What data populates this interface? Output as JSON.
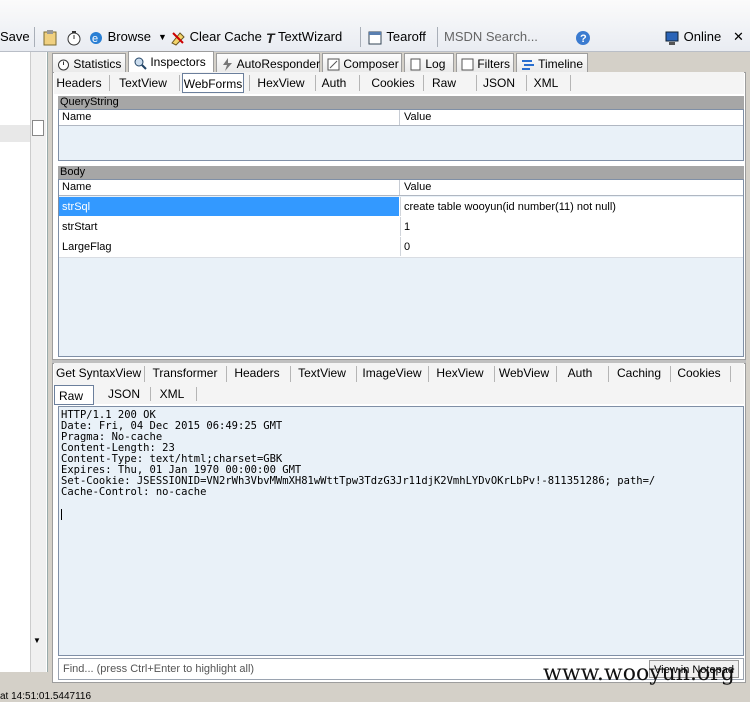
{
  "toolbar": {
    "save": "Save",
    "browse": "Browse",
    "clear_cache": "Clear Cache",
    "textwizard": "TextWizard",
    "tearoff": "Tearoff",
    "msdn_search": "MSDN Search...",
    "online": "Online"
  },
  "main_tabs": [
    "Statistics",
    "Inspectors",
    "AutoResponder",
    "Composer",
    "Log",
    "Filters",
    "Timeline"
  ],
  "request_tabs": [
    "Headers",
    "TextView",
    "WebForms",
    "HexView",
    "Auth",
    "Cookies",
    "Raw",
    "JSON",
    "XML"
  ],
  "querystring": {
    "title": "QueryString",
    "col_name": "Name",
    "col_value": "Value"
  },
  "body": {
    "title": "Body",
    "col_name": "Name",
    "col_value": "Value",
    "rows": [
      {
        "name": "strSql",
        "value": "create table wooyun(id number(11) not null)"
      },
      {
        "name": "strStart",
        "value": "1"
      },
      {
        "name": "LargeFlag",
        "value": "0"
      }
    ]
  },
  "response_tabs_row1": [
    "Get SyntaxView",
    "Transformer",
    "Headers",
    "TextView",
    "ImageView",
    "HexView",
    "WebView",
    "Auth",
    "Caching",
    "Cookies"
  ],
  "response_tabs_row2": [
    "Raw",
    "JSON",
    "XML"
  ],
  "response_text": "HTTP/1.1 200 OK\nDate: Fri, 04 Dec 2015 06:49:25 GMT\nPragma: No-cache\nContent-Length: 23\nContent-Type: text/html;charset=GBK\nExpires: Thu, 01 Jan 1970 00:00:00 GMT\nSet-Cookie: JSESSIONID=VN2rWh3VbvMWmXH81wWttTpw3TdzG3Jr11djK2VmhLYDvOKrLbPv!-811351286; path=/\nCache-Control: no-cache",
  "find_placeholder": "Find... (press Ctrl+Enter to highlight all)",
  "view_notepad": "View in Notepad",
  "watermark": "www.wooyun.org",
  "statusbar_text": "at 14:51:01.5447116"
}
